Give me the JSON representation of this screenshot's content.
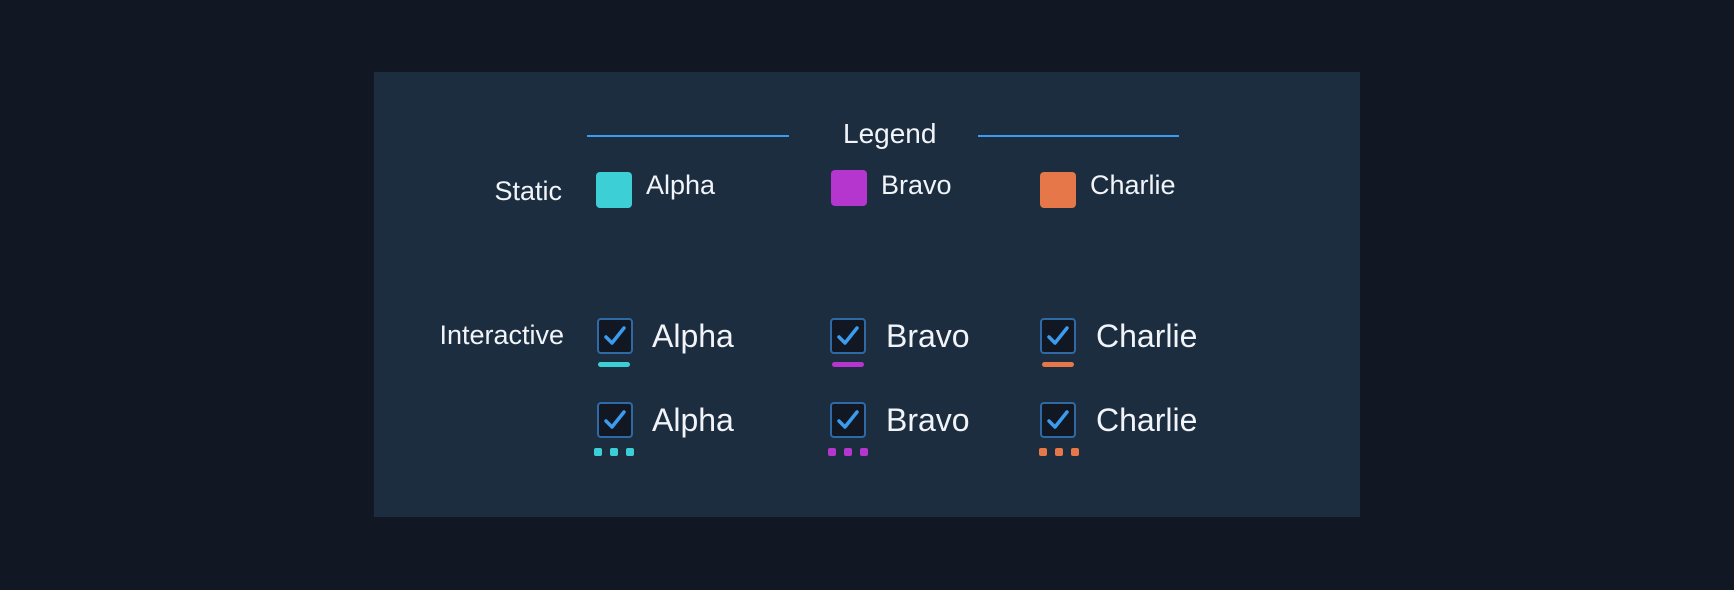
{
  "legend": {
    "title": "Legend",
    "line_color": "#3b9bee"
  },
  "rows": {
    "static_label": "Static",
    "interactive_label": "Interactive"
  },
  "series": [
    {
      "name": "Alpha",
      "color": "#3ccfd6"
    },
    {
      "name": "Bravo",
      "color": "#b535cf"
    },
    {
      "name": "Charlie",
      "color": "#e57748"
    }
  ],
  "interactive_rows": [
    {
      "style": "solid",
      "items": [
        {
          "label": "Alpha",
          "checked": true
        },
        {
          "label": "Bravo",
          "checked": true
        },
        {
          "label": "Charlie",
          "checked": true
        }
      ]
    },
    {
      "style": "dotted",
      "items": [
        {
          "label": "Alpha",
          "checked": true
        },
        {
          "label": "Bravo",
          "checked": true
        },
        {
          "label": "Charlie",
          "checked": true
        }
      ]
    }
  ]
}
